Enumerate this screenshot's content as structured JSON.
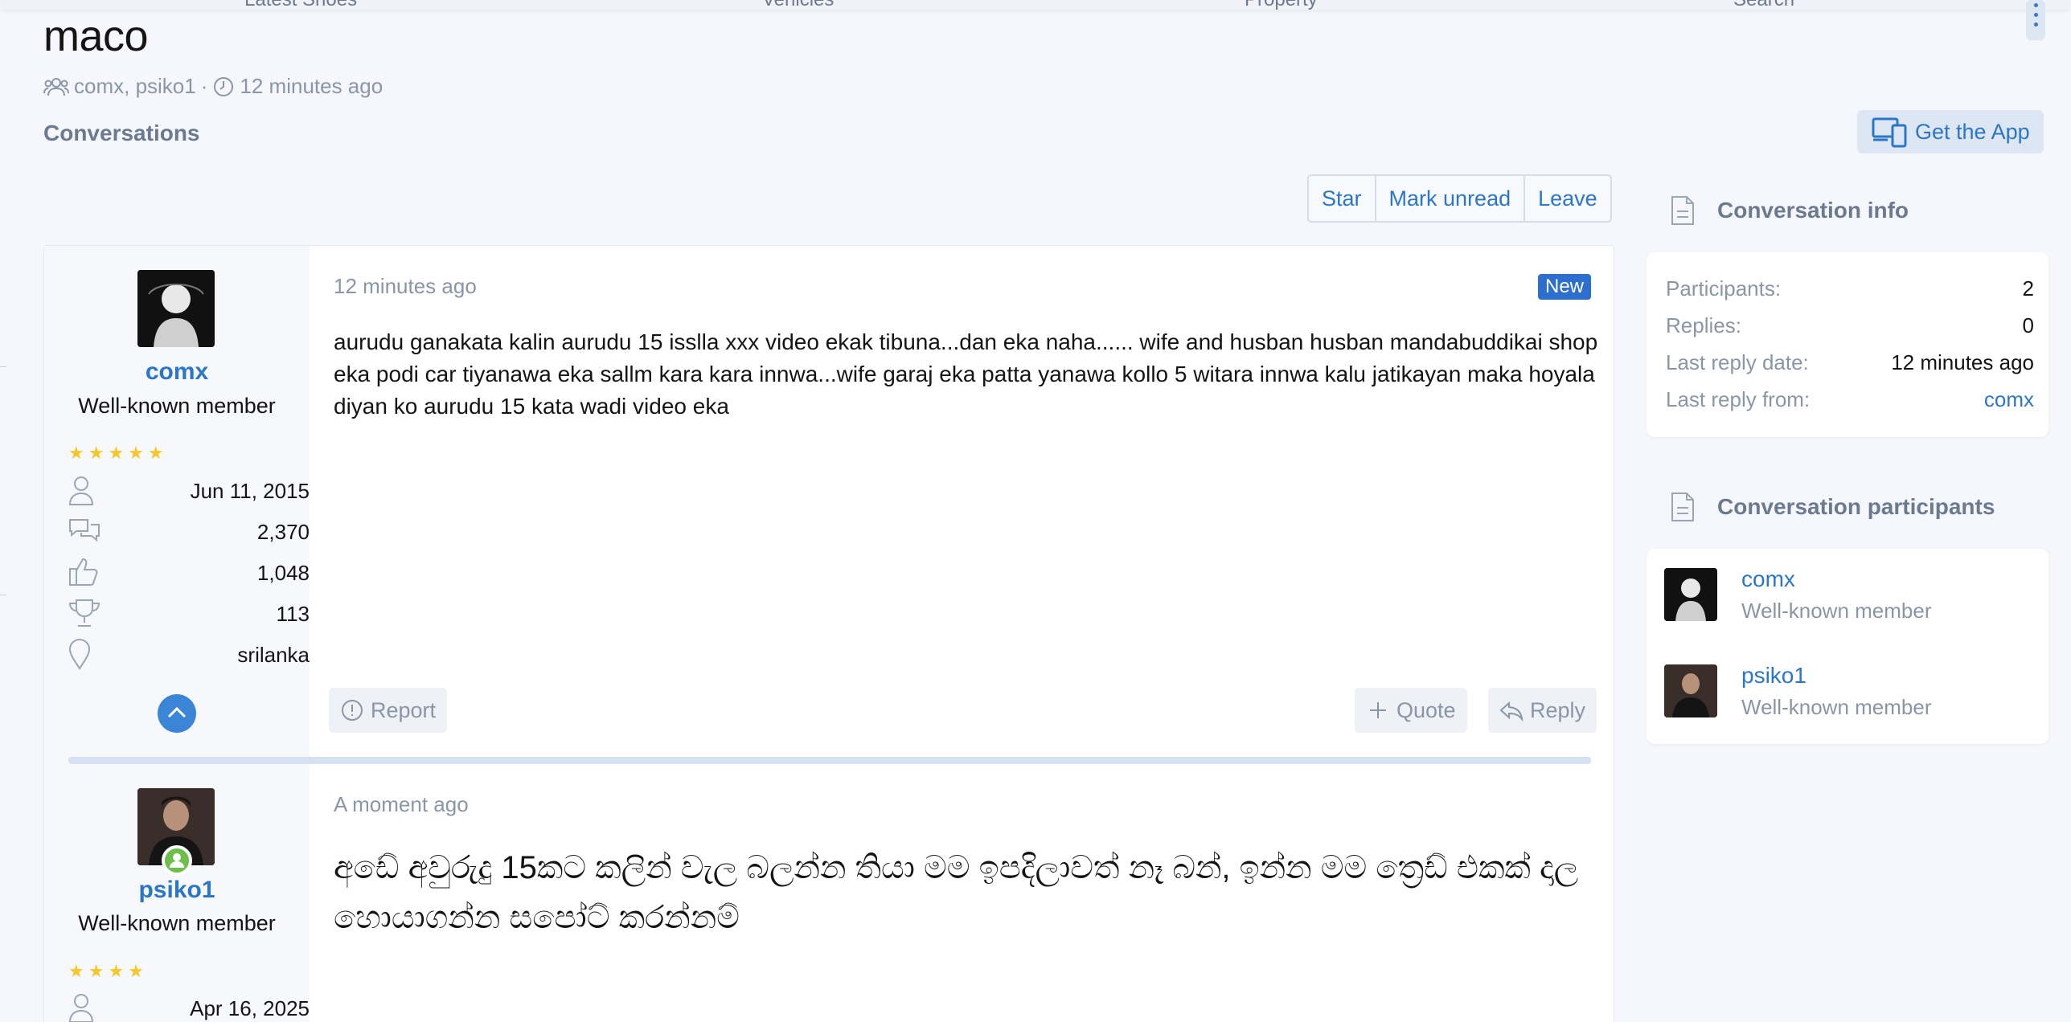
{
  "nav": {
    "items": [
      "Latest Shoes",
      "Vehicles",
      "Property",
      "Search"
    ]
  },
  "page": {
    "title": "maco",
    "participants_line": "comx, psiko1",
    "separator": "·",
    "time": "12 minutes ago",
    "breadcrumb": "Conversations"
  },
  "app_button": {
    "label": "Get the App",
    "icon": "devices-icon"
  },
  "actions": {
    "star": "Star",
    "mark_unread": "Mark unread",
    "leave": "Leave"
  },
  "messages": [
    {
      "user": "comx",
      "title": "Well-known member",
      "stars": "★★★★★",
      "joined": "Jun 11, 2015",
      "messages": "2,370",
      "reactions": "1,048",
      "points": "113",
      "location": "srilanka",
      "time": "12 minutes ago",
      "badge": "New",
      "body": "aurudu ganakata kalin aurudu 15 isslla xxx video ekak tibuna...dan eka naha...... wife and husban husban mandabuddikai shop eka podi car tiyanawa eka sallm kara kara innwa...wife garaj eka patta yanawa kollo 5 witara innwa kalu jatikayan maka hoyala diyan ko aurudu 15 kata wadi video eka",
      "report": "Report",
      "quote": "Quote",
      "reply": "Reply"
    },
    {
      "user": "psiko1",
      "title": "Well-known member",
      "stars": "★★★★",
      "joined": "Apr 16, 2025",
      "time": "A moment ago",
      "body": "අඩේ අවුරුදු 15කට කලින් වැල බලන්න තියා මම ඉපදිලාවත් නෑ බන්, ඉන්න මම ත්‍රෙඩ් එකක් දාල හොයාගන්න සපෝට් කරන්නම්"
    }
  ],
  "sidebar": {
    "info": {
      "heading": "Conversation info",
      "participants_label": "Participants:",
      "participants_value": "2",
      "replies_label": "Replies:",
      "replies_value": "0",
      "last_date_label": "Last reply date:",
      "last_date_value": "12 minutes ago",
      "last_from_label": "Last reply from:",
      "last_from_value": "comx"
    },
    "participants": {
      "heading": "Conversation participants",
      "list": [
        {
          "name": "comx",
          "title": "Well-known member"
        },
        {
          "name": "psiko1",
          "title": "Well-known member"
        }
      ]
    }
  },
  "colors": {
    "link": "#2c76c8",
    "badge": "#2c6fd1",
    "star": "#f5c72b",
    "online": "#6bbf4a"
  }
}
